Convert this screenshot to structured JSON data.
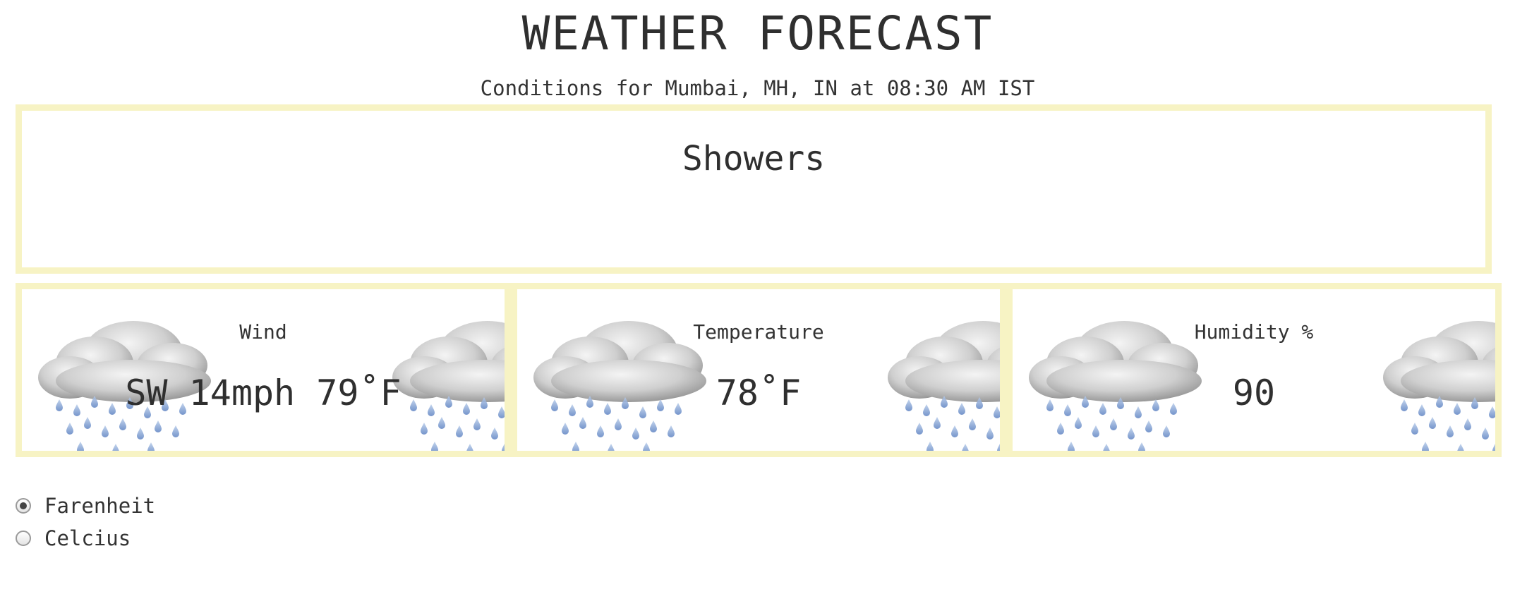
{
  "header": {
    "title": "WEATHER FORECAST",
    "subtitle": "Conditions for Mumbai, MH, IN at 08:30 AM IST"
  },
  "summary": {
    "condition": "Showers"
  },
  "cards": [
    {
      "label": "Wind",
      "value": "SW 14mph 79˚F",
      "icon": "rain-cloud-icon"
    },
    {
      "label": "Temperature",
      "value": "78˚F",
      "icon": "rain-cloud-icon"
    },
    {
      "label": "Humidity %",
      "value": "90",
      "icon": "rain-cloud-icon"
    }
  ],
  "units": {
    "options": [
      {
        "label": "Farenheit",
        "checked": true
      },
      {
        "label": "Celcius",
        "checked": false
      }
    ]
  },
  "colors": {
    "border": "#f7f3c4",
    "text": "#333333",
    "raindrop": "#6f92c9"
  }
}
